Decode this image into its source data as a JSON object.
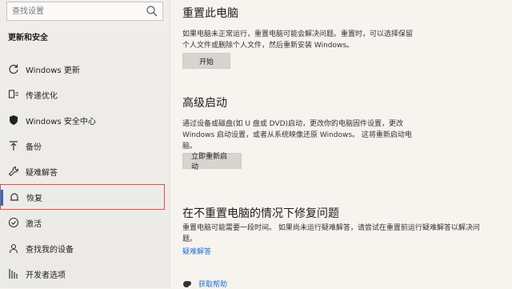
{
  "search": {
    "placeholder": "查找设置"
  },
  "sidebar": {
    "title": "更新和安全",
    "items": [
      {
        "label": "Windows 更新",
        "icon": "refresh-icon"
      },
      {
        "label": "传递优化",
        "icon": "delivery-icon"
      },
      {
        "label": "Windows 安全中心",
        "icon": "shield-icon"
      },
      {
        "label": "备份",
        "icon": "backup-arrow-icon"
      },
      {
        "label": "疑难解答",
        "icon": "wrench-icon"
      },
      {
        "label": "恢复",
        "icon": "recovery-icon",
        "active": true
      },
      {
        "label": "激活",
        "icon": "check-circle-icon"
      },
      {
        "label": "查找我的设备",
        "icon": "person-pin-icon"
      },
      {
        "label": "开发者选项",
        "icon": "developer-icon"
      }
    ]
  },
  "main": {
    "reset": {
      "title": "重置此电脑",
      "line1": "如果电脑未正常运行，重置电脑可能会解决问题。重置时，可以选择保留",
      "line2": "个人文件或删除个人文件，然后重新安装 Windows。",
      "button": "开始"
    },
    "advanced": {
      "title": "高级启动",
      "line1": "通过设备或磁盘(如 U 盘或 DVD)启动，更改你的电脑固件设置，更改",
      "line2": "Windows 启动设置，或者从系统映像还原 Windows。 这将重新启动电",
      "line3": "脑。",
      "button": "立即重新启动"
    },
    "fix": {
      "title": "在不重置电脑的情况下修复问题",
      "line1": "重置电脑可能需要一段时间。 如果尚未运行疑难解答，请尝试在重置前运行疑难解答以解决问",
      "line2": "题。",
      "link": "疑难解答"
    },
    "help": {
      "label": "获取帮助",
      "icon": "help-chat-icon"
    }
  },
  "colors": {
    "accent": "#1c6fd1",
    "highlight_border": "#e24c4c"
  }
}
